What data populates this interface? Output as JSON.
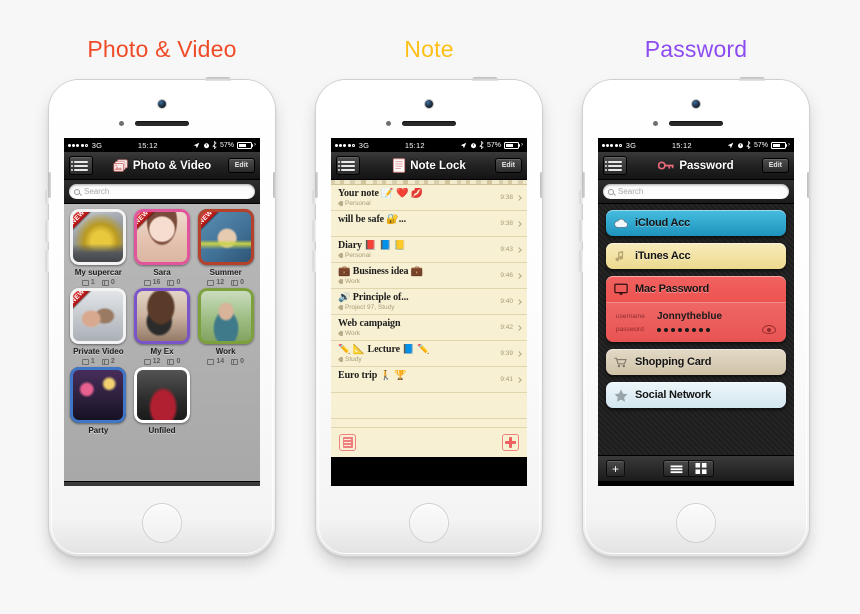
{
  "captions": [
    {
      "label": "Photo & Video",
      "color": "#f04b28"
    },
    {
      "label": "Note",
      "color": "#fcc017"
    },
    {
      "label": "Password",
      "color": "#8d4cf0"
    }
  ],
  "status_bar": {
    "carrier": "3G",
    "time": "15:12",
    "battery_percent": "57%"
  },
  "photo_app": {
    "nav_title": "Photo & Video",
    "edit_label": "Edit",
    "search_placeholder": "Search",
    "menu_icon": "hamburger-list-icon",
    "title_icon": "photo-stack-icon",
    "new_badge": "NEW",
    "albums": [
      {
        "name": "My supercar",
        "photos": "1",
        "videos": "0",
        "new": true,
        "frame": "#ffffff",
        "theme": "#b9a34a"
      },
      {
        "name": "Sara",
        "photos": "16",
        "videos": "0",
        "new": true,
        "frame": "#e0559c",
        "theme": "#e8b7a0"
      },
      {
        "name": "Summer",
        "photos": "12",
        "videos": "0",
        "new": true,
        "frame": "#b5412a",
        "theme": "#4e7f9e"
      },
      {
        "name": "Private Video",
        "photos": "1",
        "videos": "2",
        "new": true,
        "frame": "#ffffff",
        "theme": "#c8cbd0"
      },
      {
        "name": "My Ex",
        "photos": "12",
        "videos": "0",
        "new": false,
        "frame": "#7a55c9",
        "theme": "#caa municipality"
      },
      {
        "name": "Work",
        "photos": "14",
        "videos": "0",
        "new": false,
        "frame": "#7ea03c",
        "theme": "#7fa05c"
      },
      {
        "name": "Party",
        "photos": "",
        "videos": "",
        "new": false,
        "frame": "#3f76c6",
        "theme": "#2a2438"
      },
      {
        "name": "Unfiled",
        "photos": "",
        "videos": "",
        "new": false,
        "frame": "#ffffff",
        "theme": "#3a3a3a"
      }
    ],
    "toolbar": [
      {
        "icon": "add-folder-icon",
        "selected": false
      },
      {
        "icon": "list-view-icon",
        "selected": false
      },
      {
        "icon": "grid-view-icon",
        "selected": true
      },
      {
        "icon": "map-view-icon",
        "selected": false
      }
    ]
  },
  "note_app": {
    "nav_title": "Note Lock",
    "edit_label": "Edit",
    "menu_icon": "hamburger-list-icon",
    "title_icon": "note-page-icon",
    "notes": [
      {
        "title": "Your note 📝 ❤️ 💋",
        "tag": "Personal",
        "time": "9:38"
      },
      {
        "title": "will be safe 🔐...",
        "tag": "",
        "time": "9:38"
      },
      {
        "title": "Diary 📕 📘 📒",
        "tag": "Personal",
        "time": "9:43"
      },
      {
        "title": "💼 Business idea 💼",
        "tag": "Work",
        "time": "9:46"
      },
      {
        "title": "🔊 Principle of...",
        "tag": "Project 97, Study",
        "time": "9:40"
      },
      {
        "title": "Web campaign",
        "tag": "Work",
        "time": "9:42"
      },
      {
        "title": "✏️ 📐 Lecture 📘 ✏️",
        "tag": "Study",
        "time": "9:39"
      },
      {
        "title": "Euro trip 🚶 🏆",
        "tag": "",
        "time": "9:41"
      }
    ],
    "toolbar": [
      {
        "icon": "note-list-icon"
      },
      {
        "icon": "add-note-icon"
      }
    ]
  },
  "password_app": {
    "nav_title": "Password",
    "edit_label": "Edit",
    "search_placeholder": "Search",
    "menu_icon": "hamburger-list-icon",
    "title_icon": "key-icon",
    "entries": [
      {
        "title": "iCloud Acc",
        "icon": "cloud-icon",
        "color": "#2fa8cf",
        "expanded": false
      },
      {
        "title": "iTunes Acc",
        "icon": "music-note-icon",
        "color": "#f2e3a8",
        "expanded": false
      },
      {
        "title": "Mac Password",
        "icon": "monitor-icon",
        "color": "#ef4a48",
        "expanded": true,
        "username_label": "username",
        "username": "Jonnytheblue",
        "password_label": "password",
        "password_masked": "••••••••",
        "reveal_icon": "eye-icon"
      },
      {
        "title": "Shopping Card",
        "icon": "shopping-cart-icon",
        "color": "#d8cdb7",
        "expanded": false
      },
      {
        "title": "Social Network",
        "icon": "star-icon",
        "color": "#dcecf2",
        "expanded": false
      }
    ],
    "toolbar": {
      "add_label": "+",
      "views": [
        {
          "icon": "list-view-icon",
          "selected": false
        },
        {
          "icon": "grid-view-icon",
          "selected": false
        }
      ]
    }
  }
}
